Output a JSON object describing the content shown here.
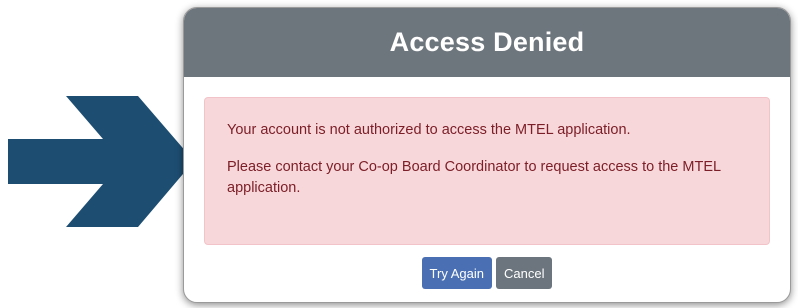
{
  "dialog": {
    "title": "Access Denied",
    "message_1": "Your account is not authorized to access the MTEL application.",
    "message_2": "Please contact your Co-op Board Coordinator to request access to the MTEL application.",
    "try_again_label": "Try Again",
    "cancel_label": "Cancel"
  },
  "colors": {
    "arrow": "#1d4e72",
    "header_bg": "#6e767d",
    "alert_bg": "#f8d7da",
    "alert_text": "#7b1e27",
    "primary_button": "#4a70b3",
    "secondary_button": "#6c757d"
  },
  "icons": {
    "pointer": "right-arrow-icon"
  }
}
